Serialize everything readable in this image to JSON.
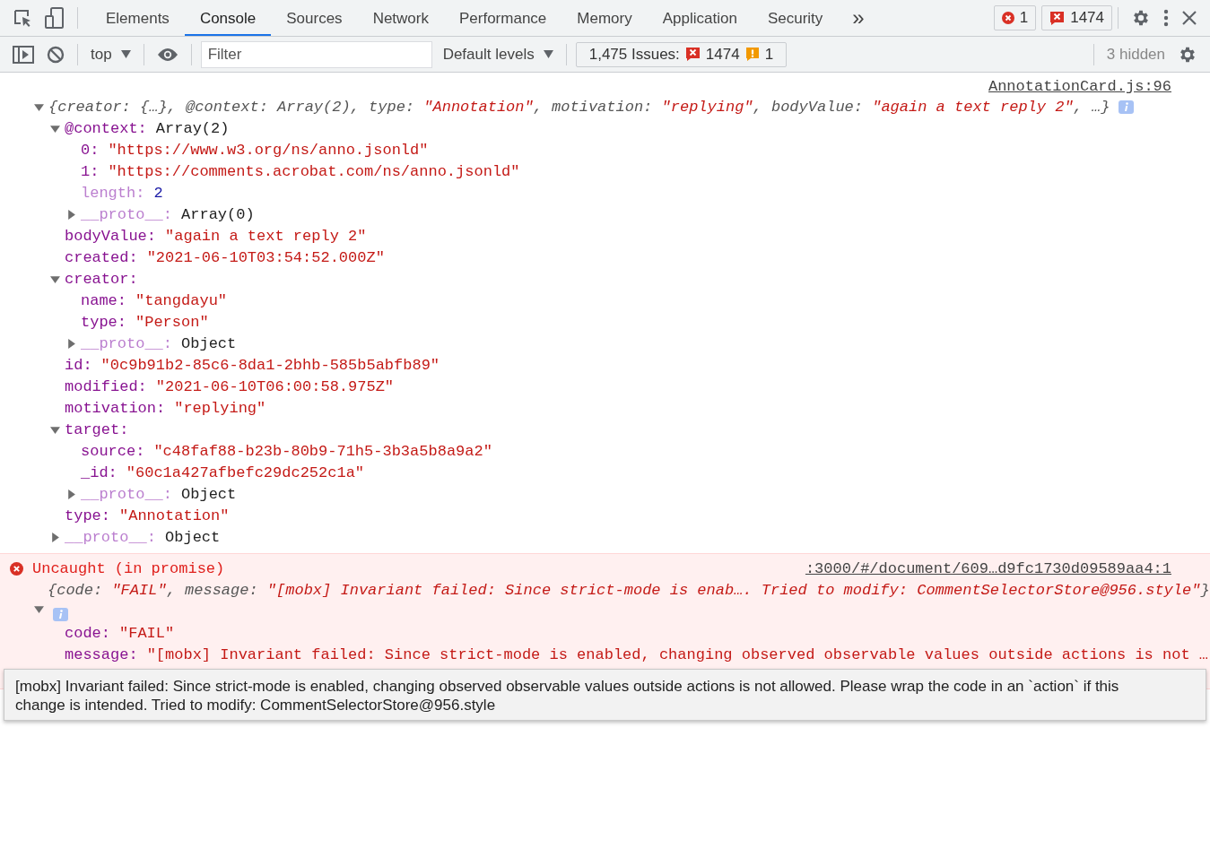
{
  "toolbar": {
    "tabs": [
      {
        "label": "Elements",
        "selected": false
      },
      {
        "label": "Console",
        "selected": true
      },
      {
        "label": "Sources",
        "selected": false
      },
      {
        "label": "Network",
        "selected": false
      },
      {
        "label": "Performance",
        "selected": false
      },
      {
        "label": "Memory",
        "selected": false
      },
      {
        "label": "Application",
        "selected": false
      },
      {
        "label": "Security",
        "selected": false
      }
    ],
    "more": "»",
    "error_count": "1",
    "issue_count": "1474"
  },
  "console_toolbar": {
    "context": "top",
    "filter_placeholder": "Filter",
    "levels": "Default levels",
    "issues_label": "1,475 Issues:",
    "issue_errors": "1474",
    "issue_warnings": "1",
    "hidden": "3 hidden"
  },
  "messages": [
    {
      "kind": "log",
      "source": "AnnotationCard.js:96",
      "expanded": true,
      "summary": [
        {
          "text": "{creator: {…}, @context: Array(2), type: ",
          "kind": "plain"
        },
        {
          "text": "\"Annotation\"",
          "kind": "string"
        },
        {
          "text": ", motivation: ",
          "kind": "plain"
        },
        {
          "text": "\"replying\"",
          "kind": "string"
        },
        {
          "text": ", bodyValue: ",
          "kind": "plain"
        },
        {
          "text": "\"again a text reply 2\"",
          "kind": "string"
        },
        {
          "text": ", …}",
          "kind": "plain"
        }
      ],
      "children": [
        {
          "key": "@context:",
          "value": "Array(2)",
          "kind": "object",
          "dim": false,
          "expanded": true,
          "children": [
            {
              "key": "0:",
              "value": "\"https://www.w3.org/ns/anno.jsonld\"",
              "kind": "string",
              "dim": false
            },
            {
              "key": "1:",
              "value": "\"https://comments.acrobat.com/ns/anno.jsonld\"",
              "kind": "string",
              "dim": false
            },
            {
              "key": "length:",
              "value": "2",
              "kind": "number",
              "dim": true
            },
            {
              "key": "__proto__:",
              "value": "Array(0)",
              "kind": "object",
              "dim": true,
              "expanded": false
            }
          ]
        },
        {
          "key": "bodyValue:",
          "value": "\"again a text reply 2\"",
          "kind": "string",
          "dim": false
        },
        {
          "key": "created:",
          "value": "\"2021-06-10T03:54:52.000Z\"",
          "kind": "string",
          "dim": false
        },
        {
          "key": "creator:",
          "dim": false,
          "expanded": true,
          "children": [
            {
              "key": "name:",
              "value": "\"tangdayu\"",
              "kind": "string",
              "dim": false
            },
            {
              "key": "type:",
              "value": "\"Person\"",
              "kind": "string",
              "dim": false
            },
            {
              "key": "__proto__:",
              "value": "Object",
              "kind": "object",
              "dim": true,
              "expanded": false
            }
          ]
        },
        {
          "key": "id:",
          "value": "\"0c9b91b2-85c6-8da1-2bhb-585b5abfb89\"",
          "kind": "string",
          "dim": false
        },
        {
          "key": "modified:",
          "value": "\"2021-06-10T06:00:58.975Z\"",
          "kind": "string",
          "dim": false
        },
        {
          "key": "motivation:",
          "value": "\"replying\"",
          "kind": "string",
          "dim": false
        },
        {
          "key": "target:",
          "dim": false,
          "expanded": true,
          "children": [
            {
              "key": "source:",
              "value": "\"c48faf88-b23b-80b9-71h5-3b3a5b8a9a2\"",
              "kind": "string",
              "dim": false
            },
            {
              "key": "_id:",
              "value": "\"60c1a427afbefc29dc252c1a\"",
              "kind": "string",
              "dim": false
            },
            {
              "key": "__proto__:",
              "value": "Object",
              "kind": "object",
              "dim": true,
              "expanded": false
            }
          ]
        },
        {
          "key": "type:",
          "value": "\"Annotation\"",
          "kind": "string",
          "dim": false
        },
        {
          "key": "__proto__:",
          "value": "Object",
          "kind": "object",
          "dim": true,
          "expanded": false
        }
      ]
    },
    {
      "kind": "error",
      "title": "Uncaught (in promise)",
      "source": ":3000/#/document/609…d9fc1730d09589aa4:1",
      "expanded": true,
      "summary": [
        {
          "text": "{code: ",
          "kind": "plain"
        },
        {
          "text": "\"FAIL\"",
          "kind": "string"
        },
        {
          "text": ", message: ",
          "kind": "plain"
        },
        {
          "text": "\"[mobx] Invariant failed: Since strict-mode is enab…. Tried to modify: CommentSelectorStore@956.style\"",
          "kind": "string"
        },
        {
          "text": "}",
          "kind": "plain"
        }
      ],
      "children": [
        {
          "key": "code:",
          "value": "\"FAIL\"",
          "kind": "string",
          "dim": false
        },
        {
          "key": "message:",
          "value": "\"[mobx] Invariant failed: Since strict-mode is enabled, changing observed observable values outside actions is not …",
          "kind": "string",
          "dim": false
        }
      ]
    }
  ],
  "tooltip": "[mobx] Invariant failed: Since strict-mode is enabled, changing observed observable values outside actions is not allowed. Please wrap the code in an `action` if this change is intended. Tried to modify: CommentSelectorStore@956.style"
}
